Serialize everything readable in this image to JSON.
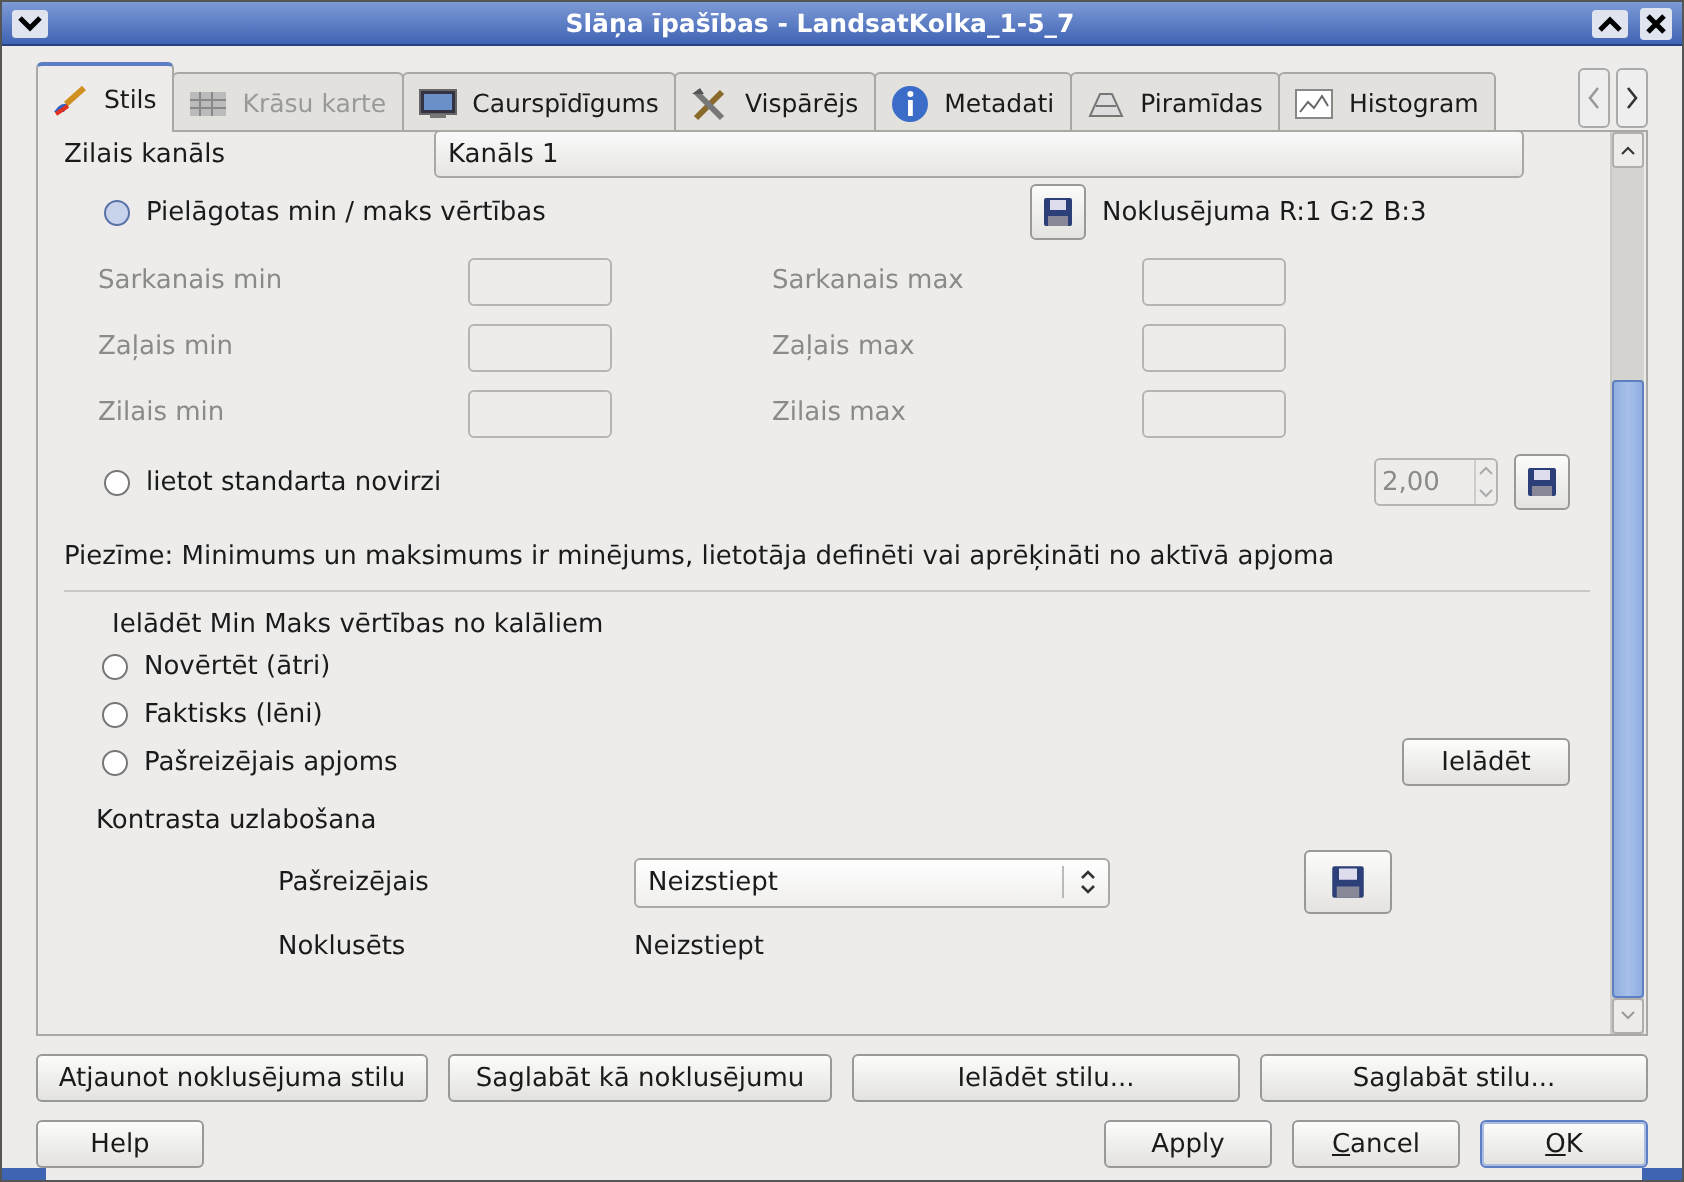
{
  "window": {
    "title": "Slāņa īpašības - LandsatKolka_1-5_7"
  },
  "tabs": [
    {
      "label": "Stils",
      "kind": "brush",
      "selected": true,
      "disabled": false
    },
    {
      "label": "Krāsu karte",
      "kind": "grid",
      "selected": false,
      "disabled": true
    },
    {
      "label": "Caurspīdīgums",
      "kind": "monitor",
      "selected": false,
      "disabled": false
    },
    {
      "label": "Vispārējs",
      "kind": "tools",
      "selected": false,
      "disabled": false
    },
    {
      "label": "Metadati",
      "kind": "info",
      "selected": false,
      "disabled": false
    },
    {
      "label": "Piramīdas",
      "kind": "pyramid",
      "selected": false,
      "disabled": false
    },
    {
      "label": "Histogram",
      "kind": "chart",
      "selected": false,
      "disabled": false
    }
  ],
  "top_row": {
    "label": "Zilais kanāls",
    "value": "Kanāls 1"
  },
  "custom_minmax": {
    "label": "Pielāgotas min / maks vērtības",
    "checked": false,
    "default_label": "Noklusējuma R:1 G:2 B:3"
  },
  "minmax_fields": [
    {
      "left": "Sarkanais min",
      "right": "Sarkanais max"
    },
    {
      "left": "Zaļais min",
      "right": "Zaļais max"
    },
    {
      "left": "Zilais min",
      "right": "Zilais max"
    }
  ],
  "std_dev": {
    "label": "lietot standarta novirzi",
    "checked": false,
    "value": "2,00"
  },
  "note": "Piezīme: Minimums un maksimums ir minējums, lietotāja definēti vai aprēķināti no aktīvā apjoma",
  "load_group": {
    "title": "Ielādēt Min Maks vērtības no kalāliem",
    "options": [
      {
        "label": "Novērtēt (ātri)",
        "selected": false
      },
      {
        "label": "Faktisks (lēni)",
        "selected": false
      },
      {
        "label": "Pašreizējais apjoms",
        "selected": false
      }
    ],
    "button": "Ielādēt"
  },
  "contrast": {
    "title": "Kontrasta uzlabošana",
    "current_label": "Pašreizējais",
    "current_value": "Neizstiept",
    "default_label": "Noklusēts",
    "default_value": "Neizstiept"
  },
  "style_buttons": [
    "Atjaunot noklusējuma stilu",
    "Saglabāt kā noklusējumu",
    "Ielādēt stilu...",
    "Saglabāt stilu..."
  ],
  "help_button": "Help",
  "dialog_buttons": [
    {
      "label": "Apply",
      "mnemonic": false,
      "default": false
    },
    {
      "label": "Cancel",
      "mnemonic": true,
      "default": false
    },
    {
      "label": "OK",
      "mnemonic": true,
      "default": true
    }
  ]
}
